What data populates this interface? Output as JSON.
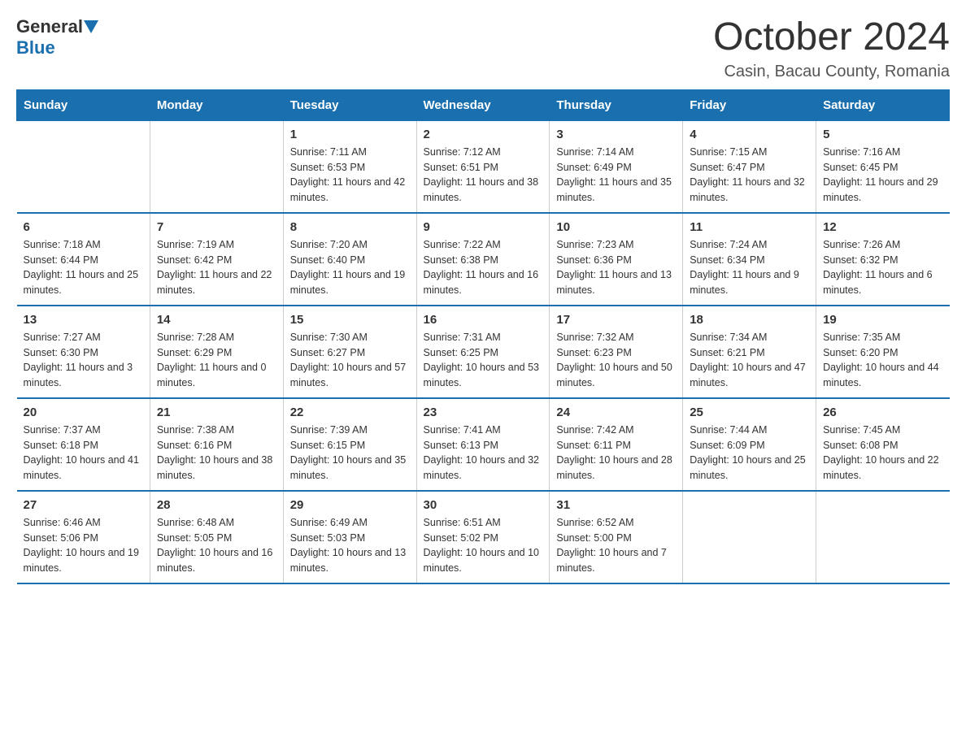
{
  "header": {
    "logo": {
      "general": "General",
      "blue": "Blue",
      "triangle_color": "#1a6faf"
    },
    "title": "October 2024",
    "location": "Casin, Bacau County, Romania"
  },
  "calendar": {
    "days_of_week": [
      "Sunday",
      "Monday",
      "Tuesday",
      "Wednesday",
      "Thursday",
      "Friday",
      "Saturday"
    ],
    "weeks": [
      [
        {
          "day": "",
          "sunrise": "",
          "sunset": "",
          "daylight": ""
        },
        {
          "day": "",
          "sunrise": "",
          "sunset": "",
          "daylight": ""
        },
        {
          "day": "1",
          "sunrise": "Sunrise: 7:11 AM",
          "sunset": "Sunset: 6:53 PM",
          "daylight": "Daylight: 11 hours and 42 minutes."
        },
        {
          "day": "2",
          "sunrise": "Sunrise: 7:12 AM",
          "sunset": "Sunset: 6:51 PM",
          "daylight": "Daylight: 11 hours and 38 minutes."
        },
        {
          "day": "3",
          "sunrise": "Sunrise: 7:14 AM",
          "sunset": "Sunset: 6:49 PM",
          "daylight": "Daylight: 11 hours and 35 minutes."
        },
        {
          "day": "4",
          "sunrise": "Sunrise: 7:15 AM",
          "sunset": "Sunset: 6:47 PM",
          "daylight": "Daylight: 11 hours and 32 minutes."
        },
        {
          "day": "5",
          "sunrise": "Sunrise: 7:16 AM",
          "sunset": "Sunset: 6:45 PM",
          "daylight": "Daylight: 11 hours and 29 minutes."
        }
      ],
      [
        {
          "day": "6",
          "sunrise": "Sunrise: 7:18 AM",
          "sunset": "Sunset: 6:44 PM",
          "daylight": "Daylight: 11 hours and 25 minutes."
        },
        {
          "day": "7",
          "sunrise": "Sunrise: 7:19 AM",
          "sunset": "Sunset: 6:42 PM",
          "daylight": "Daylight: 11 hours and 22 minutes."
        },
        {
          "day": "8",
          "sunrise": "Sunrise: 7:20 AM",
          "sunset": "Sunset: 6:40 PM",
          "daylight": "Daylight: 11 hours and 19 minutes."
        },
        {
          "day": "9",
          "sunrise": "Sunrise: 7:22 AM",
          "sunset": "Sunset: 6:38 PM",
          "daylight": "Daylight: 11 hours and 16 minutes."
        },
        {
          "day": "10",
          "sunrise": "Sunrise: 7:23 AM",
          "sunset": "Sunset: 6:36 PM",
          "daylight": "Daylight: 11 hours and 13 minutes."
        },
        {
          "day": "11",
          "sunrise": "Sunrise: 7:24 AM",
          "sunset": "Sunset: 6:34 PM",
          "daylight": "Daylight: 11 hours and 9 minutes."
        },
        {
          "day": "12",
          "sunrise": "Sunrise: 7:26 AM",
          "sunset": "Sunset: 6:32 PM",
          "daylight": "Daylight: 11 hours and 6 minutes."
        }
      ],
      [
        {
          "day": "13",
          "sunrise": "Sunrise: 7:27 AM",
          "sunset": "Sunset: 6:30 PM",
          "daylight": "Daylight: 11 hours and 3 minutes."
        },
        {
          "day": "14",
          "sunrise": "Sunrise: 7:28 AM",
          "sunset": "Sunset: 6:29 PM",
          "daylight": "Daylight: 11 hours and 0 minutes."
        },
        {
          "day": "15",
          "sunrise": "Sunrise: 7:30 AM",
          "sunset": "Sunset: 6:27 PM",
          "daylight": "Daylight: 10 hours and 57 minutes."
        },
        {
          "day": "16",
          "sunrise": "Sunrise: 7:31 AM",
          "sunset": "Sunset: 6:25 PM",
          "daylight": "Daylight: 10 hours and 53 minutes."
        },
        {
          "day": "17",
          "sunrise": "Sunrise: 7:32 AM",
          "sunset": "Sunset: 6:23 PM",
          "daylight": "Daylight: 10 hours and 50 minutes."
        },
        {
          "day": "18",
          "sunrise": "Sunrise: 7:34 AM",
          "sunset": "Sunset: 6:21 PM",
          "daylight": "Daylight: 10 hours and 47 minutes."
        },
        {
          "day": "19",
          "sunrise": "Sunrise: 7:35 AM",
          "sunset": "Sunset: 6:20 PM",
          "daylight": "Daylight: 10 hours and 44 minutes."
        }
      ],
      [
        {
          "day": "20",
          "sunrise": "Sunrise: 7:37 AM",
          "sunset": "Sunset: 6:18 PM",
          "daylight": "Daylight: 10 hours and 41 minutes."
        },
        {
          "day": "21",
          "sunrise": "Sunrise: 7:38 AM",
          "sunset": "Sunset: 6:16 PM",
          "daylight": "Daylight: 10 hours and 38 minutes."
        },
        {
          "day": "22",
          "sunrise": "Sunrise: 7:39 AM",
          "sunset": "Sunset: 6:15 PM",
          "daylight": "Daylight: 10 hours and 35 minutes."
        },
        {
          "day": "23",
          "sunrise": "Sunrise: 7:41 AM",
          "sunset": "Sunset: 6:13 PM",
          "daylight": "Daylight: 10 hours and 32 minutes."
        },
        {
          "day": "24",
          "sunrise": "Sunrise: 7:42 AM",
          "sunset": "Sunset: 6:11 PM",
          "daylight": "Daylight: 10 hours and 28 minutes."
        },
        {
          "day": "25",
          "sunrise": "Sunrise: 7:44 AM",
          "sunset": "Sunset: 6:09 PM",
          "daylight": "Daylight: 10 hours and 25 minutes."
        },
        {
          "day": "26",
          "sunrise": "Sunrise: 7:45 AM",
          "sunset": "Sunset: 6:08 PM",
          "daylight": "Daylight: 10 hours and 22 minutes."
        }
      ],
      [
        {
          "day": "27",
          "sunrise": "Sunrise: 6:46 AM",
          "sunset": "Sunset: 5:06 PM",
          "daylight": "Daylight: 10 hours and 19 minutes."
        },
        {
          "day": "28",
          "sunrise": "Sunrise: 6:48 AM",
          "sunset": "Sunset: 5:05 PM",
          "daylight": "Daylight: 10 hours and 16 minutes."
        },
        {
          "day": "29",
          "sunrise": "Sunrise: 6:49 AM",
          "sunset": "Sunset: 5:03 PM",
          "daylight": "Daylight: 10 hours and 13 minutes."
        },
        {
          "day": "30",
          "sunrise": "Sunrise: 6:51 AM",
          "sunset": "Sunset: 5:02 PM",
          "daylight": "Daylight: 10 hours and 10 minutes."
        },
        {
          "day": "31",
          "sunrise": "Sunrise: 6:52 AM",
          "sunset": "Sunset: 5:00 PM",
          "daylight": "Daylight: 10 hours and 7 minutes."
        },
        {
          "day": "",
          "sunrise": "",
          "sunset": "",
          "daylight": ""
        },
        {
          "day": "",
          "sunrise": "",
          "sunset": "",
          "daylight": ""
        }
      ]
    ]
  }
}
